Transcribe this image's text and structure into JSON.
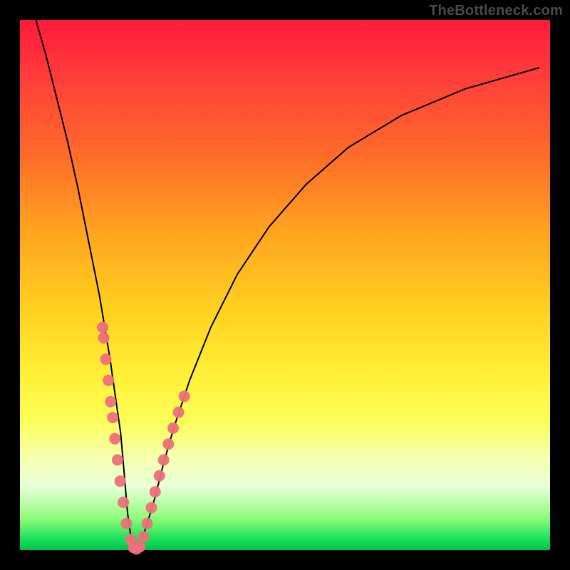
{
  "watermark_text": "TheBottleneck.com",
  "chart_data": {
    "type": "line",
    "title": "",
    "xlabel": "",
    "ylabel": "",
    "xlim": [
      0,
      100
    ],
    "ylim": [
      0,
      100
    ],
    "series": [
      {
        "name": "bottleneck-curve",
        "x": [
          3,
          5,
          7,
          9,
          11,
          13,
          15,
          17,
          18,
          19,
          19.7,
          20.3,
          21,
          21.6,
          22.2,
          23,
          24,
          25.5,
          27,
          29,
          32,
          36,
          41,
          47,
          54,
          62,
          72,
          84,
          98
        ],
        "y": [
          100,
          93,
          85,
          77,
          68,
          58,
          48,
          36,
          29,
          22,
          14,
          7,
          2,
          0,
          0.5,
          2,
          5,
          10,
          16,
          23,
          32,
          42,
          52,
          61,
          69,
          76,
          82,
          87,
          91
        ]
      }
    ],
    "dot_clusters": [
      {
        "name": "left-cluster",
        "points": [
          {
            "x": 15.6,
            "y": 42
          },
          {
            "x": 15.8,
            "y": 40
          },
          {
            "x": 16.2,
            "y": 36
          },
          {
            "x": 16.7,
            "y": 32
          },
          {
            "x": 17.1,
            "y": 28
          },
          {
            "x": 17.5,
            "y": 25
          },
          {
            "x": 17.9,
            "y": 21
          },
          {
            "x": 18.4,
            "y": 17
          },
          {
            "x": 18.9,
            "y": 13
          },
          {
            "x": 19.5,
            "y": 9
          },
          {
            "x": 20.1,
            "y": 5
          },
          {
            "x": 20.9,
            "y": 2
          }
        ]
      },
      {
        "name": "bottom-cluster",
        "points": [
          {
            "x": 21.4,
            "y": 0.5
          },
          {
            "x": 22.0,
            "y": 0.2
          },
          {
            "x": 22.6,
            "y": 0.6
          }
        ]
      },
      {
        "name": "right-cluster",
        "points": [
          {
            "x": 23.3,
            "y": 2.5
          },
          {
            "x": 24.0,
            "y": 5
          },
          {
            "x": 24.8,
            "y": 8
          },
          {
            "x": 25.5,
            "y": 11
          },
          {
            "x": 26.3,
            "y": 14
          },
          {
            "x": 27.1,
            "y": 17
          },
          {
            "x": 28.0,
            "y": 20
          },
          {
            "x": 28.9,
            "y": 23
          },
          {
            "x": 29.9,
            "y": 26
          },
          {
            "x": 31.0,
            "y": 29
          }
        ]
      }
    ],
    "dot_style": {
      "radius_px": 8,
      "fill": "#ef6f7b",
      "opacity": 0.95
    },
    "curve_style": {
      "stroke": "#000000",
      "stroke_width_px": 2
    }
  }
}
